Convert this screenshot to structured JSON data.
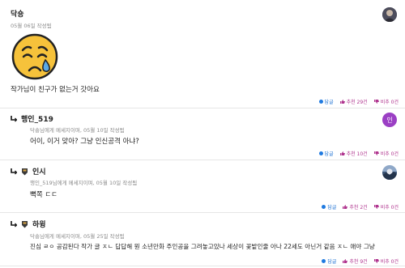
{
  "comments": [
    {
      "author": "닥숑",
      "meta": "05월 06일 작성됨",
      "text": "작가님이 친구가 없는거 갓아요",
      "actions": {
        "reply": "답글",
        "up": "추천 29건",
        "down": "비추 0건"
      }
    },
    {
      "author": "행인_519",
      "meta": "닥숑님에게 메세지이며, 05월 10일 작성됨",
      "text": "어이, 이거 맞아? 그냥 인신공격 아냐?",
      "avatar_letter": "인",
      "actions": {
        "reply": "답글",
        "up": "추천 10건",
        "down": "비추 0건"
      }
    },
    {
      "author": "인시",
      "meta": "행인_519님에게 메세지이며, 05월 10일 작성됨",
      "text": "뼉쪽 ㄷㄷ",
      "actions": {
        "reply": "답글",
        "up": "추천 2건",
        "down": "비추 0건"
      }
    },
    {
      "author": "하윙",
      "meta": "닥숑님에게 메세지이며, 05월 25일 작성됨",
      "text": "진심 ㄹㅇ 공감된다 작가 글 ㅈㄴ 답답해 뭔 소년만화 주인공을 그려놓고있나 세상이 꽃밭인줄 아나 22세도 아닌거 같음 ㅈㄴ 애야 그냥",
      "actions": {
        "reply": "답글",
        "up": "추천 9건",
        "down": "비추 0건"
      }
    }
  ],
  "colors": {
    "reply": "#1a6fd1",
    "vote": "#b0358f",
    "accent_avatar": "#9b3fc4"
  }
}
